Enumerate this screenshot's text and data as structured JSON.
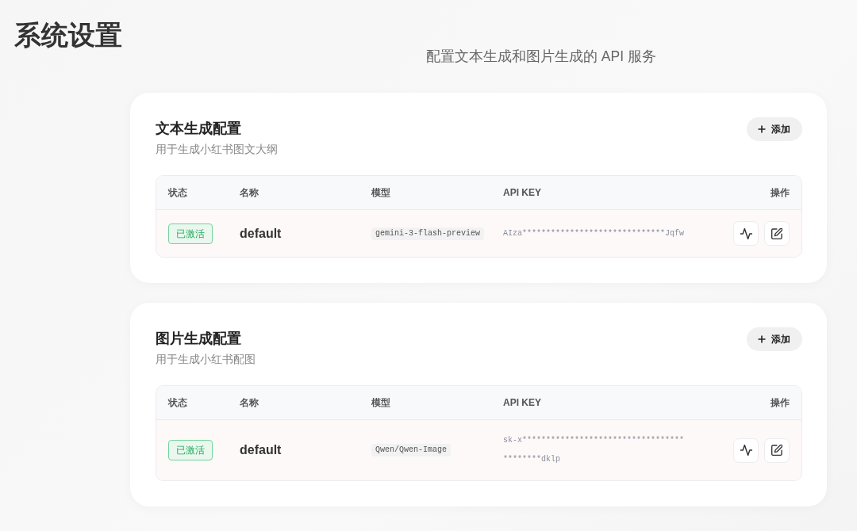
{
  "page": {
    "title": "系统设置",
    "subtitle": "配置文本生成和图片生成的 API 服务"
  },
  "sections": [
    {
      "title": "文本生成配置",
      "description": "用于生成小红书图文大纲",
      "add_button": {
        "label": "添加"
      },
      "table": {
        "columns": [
          "状态",
          "名称",
          "模型",
          "API KEY",
          "操作"
        ],
        "rows": [
          {
            "status": "已激活",
            "active": true,
            "name": "default",
            "model": "gemini-3-flash-preview",
            "api_key": "AIza******************************Jqfw"
          }
        ]
      }
    },
    {
      "title": "图片生成配置",
      "description": "用于生成小红书配图",
      "add_button": {
        "label": "添加"
      },
      "table": {
        "columns": [
          "状态",
          "名称",
          "模型",
          "API KEY",
          "操作"
        ],
        "rows": [
          {
            "status": "已激活",
            "active": true,
            "name": "default",
            "model": "Qwen/Qwen-Image",
            "api_key": "sk-x******************************************dklp"
          }
        ]
      }
    }
  ]
}
